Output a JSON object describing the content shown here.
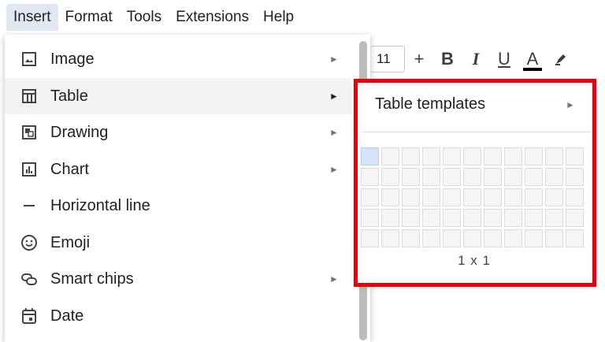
{
  "menubar": {
    "items": [
      {
        "label": "Insert",
        "active": true
      },
      {
        "label": "Format"
      },
      {
        "label": "Tools"
      },
      {
        "label": "Extensions"
      },
      {
        "label": "Help"
      }
    ]
  },
  "toolbar": {
    "font_size": "11",
    "increase_label": "+",
    "bold_label": "B",
    "italic_label": "I",
    "underline_label": "U",
    "text_color_label": "A",
    "highlight_icon": "highlighter-icon",
    "text_color_bar": "#000000"
  },
  "insert_menu": {
    "items": [
      {
        "label": "Image",
        "icon": "image-icon",
        "has_submenu": true
      },
      {
        "label": "Table",
        "icon": "table-icon",
        "has_submenu": true,
        "hovered": true
      },
      {
        "label": "Drawing",
        "icon": "drawing-icon",
        "has_submenu": true
      },
      {
        "label": "Chart",
        "icon": "chart-icon",
        "has_submenu": true
      },
      {
        "label": "Horizontal line",
        "icon": "horizontal-line-icon",
        "has_submenu": false
      },
      {
        "label": "Emoji",
        "icon": "emoji-icon",
        "has_submenu": false
      },
      {
        "label": "Smart chips",
        "icon": "smart-chips-icon",
        "has_submenu": true
      },
      {
        "label": "Date",
        "icon": "date-icon",
        "has_submenu": false
      }
    ],
    "submenu_arrow": "►"
  },
  "table_submenu": {
    "templates_label": "Table templates",
    "templates_arrow": "►",
    "grid": {
      "columns": 11,
      "rows": 5,
      "selected_columns": 1,
      "selected_rows": 1
    },
    "size_label": "1 x 1"
  },
  "colors": {
    "highlight_border": "#e8000a",
    "hover_background": "#f1f3f4",
    "active_menu_background": "#e2e8f1",
    "selected_cell": "#d6e4f8"
  }
}
